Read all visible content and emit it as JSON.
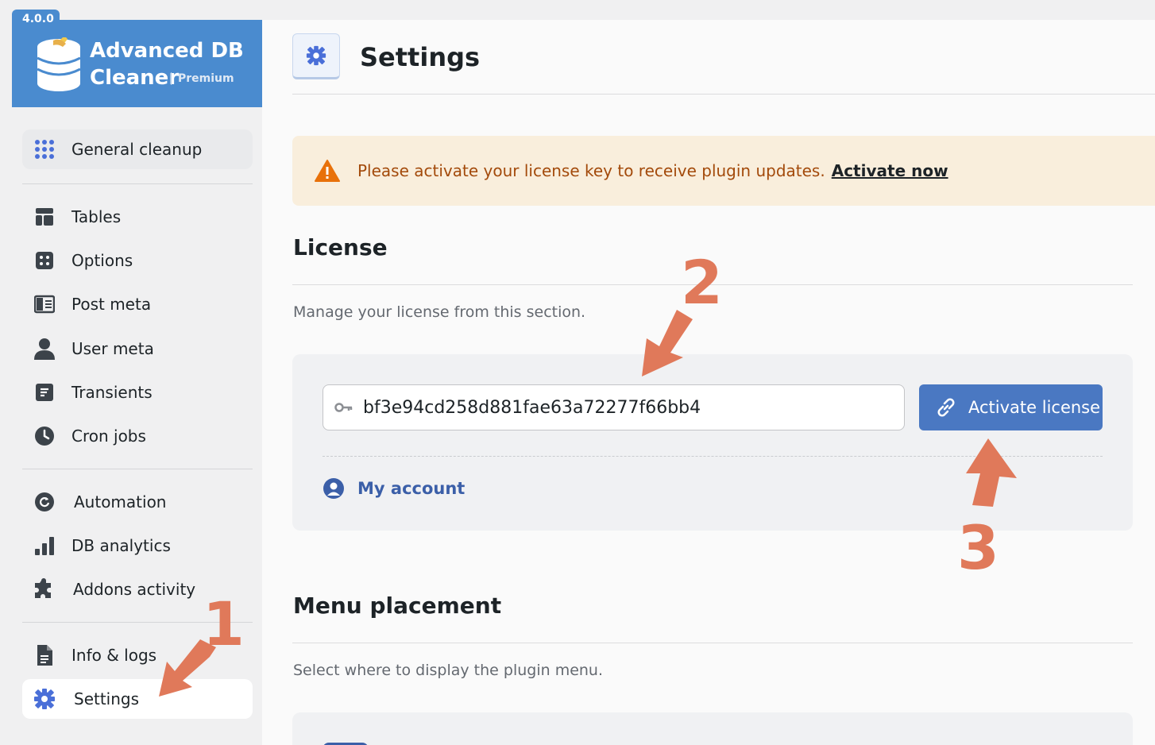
{
  "brand": {
    "version": "4.0.0",
    "title_line1": "Advanced DB",
    "title_line2": "Cleaner",
    "edition": "Premium"
  },
  "sidebar": {
    "items": [
      {
        "label": "General cleanup",
        "icon": "grid-dots-icon"
      },
      {
        "label": "Tables",
        "icon": "table-icon"
      },
      {
        "label": "Options",
        "icon": "dice-icon"
      },
      {
        "label": "Post meta",
        "icon": "post-layout-icon"
      },
      {
        "label": "User meta",
        "icon": "user-icon"
      },
      {
        "label": "Transients",
        "icon": "note-icon"
      },
      {
        "label": "Cron jobs",
        "icon": "clock-icon"
      },
      {
        "label": "Automation",
        "icon": "refresh-icon"
      },
      {
        "label": "DB analytics",
        "icon": "bar-chart-icon"
      },
      {
        "label": "Addons activity",
        "icon": "puzzle-icon"
      },
      {
        "label": "Info & logs",
        "icon": "file-icon"
      },
      {
        "label": "Settings",
        "icon": "gear-icon"
      }
    ],
    "active": "Settings"
  },
  "header": {
    "title": "Settings"
  },
  "notice": {
    "message": "Please activate your license key to receive plugin updates.",
    "link": "Activate now"
  },
  "license": {
    "title": "License",
    "description": "Manage your license from this section.",
    "key_value": "bf3e94cd258d881fae63a72277f66bb4",
    "activate_label": "Activate license",
    "my_account_label": "My account"
  },
  "menu_placement": {
    "title": "Menu placement",
    "description": "Select where to display the plugin menu."
  },
  "annotations": [
    "1",
    "2",
    "3"
  ],
  "colors": {
    "brand_blue": "#4a8bcf",
    "button_blue": "#4a78c2",
    "annotation_orange": "#e0795a",
    "notice_bg": "#f9eedc"
  }
}
